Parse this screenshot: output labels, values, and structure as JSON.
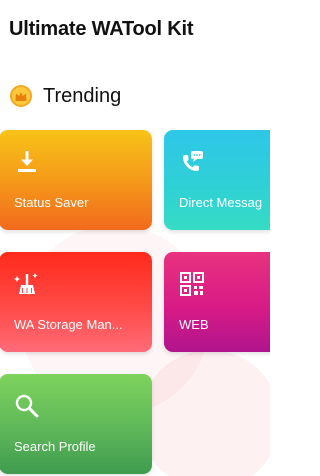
{
  "header": {
    "app_title": "Ultimate WATool Kit"
  },
  "trending": {
    "title": "Trending",
    "icon": "crown-icon"
  },
  "cards": [
    {
      "label": "Status Saver",
      "icon": "download-icon"
    },
    {
      "label": "Direct Messag",
      "icon": "phone-chat-icon"
    },
    {
      "label": "WA Storage Man...",
      "icon": "broom-icon"
    },
    {
      "label": "WEB",
      "icon": "qr-code-icon"
    },
    {
      "label": "Search Profile",
      "icon": "search-icon"
    }
  ]
}
